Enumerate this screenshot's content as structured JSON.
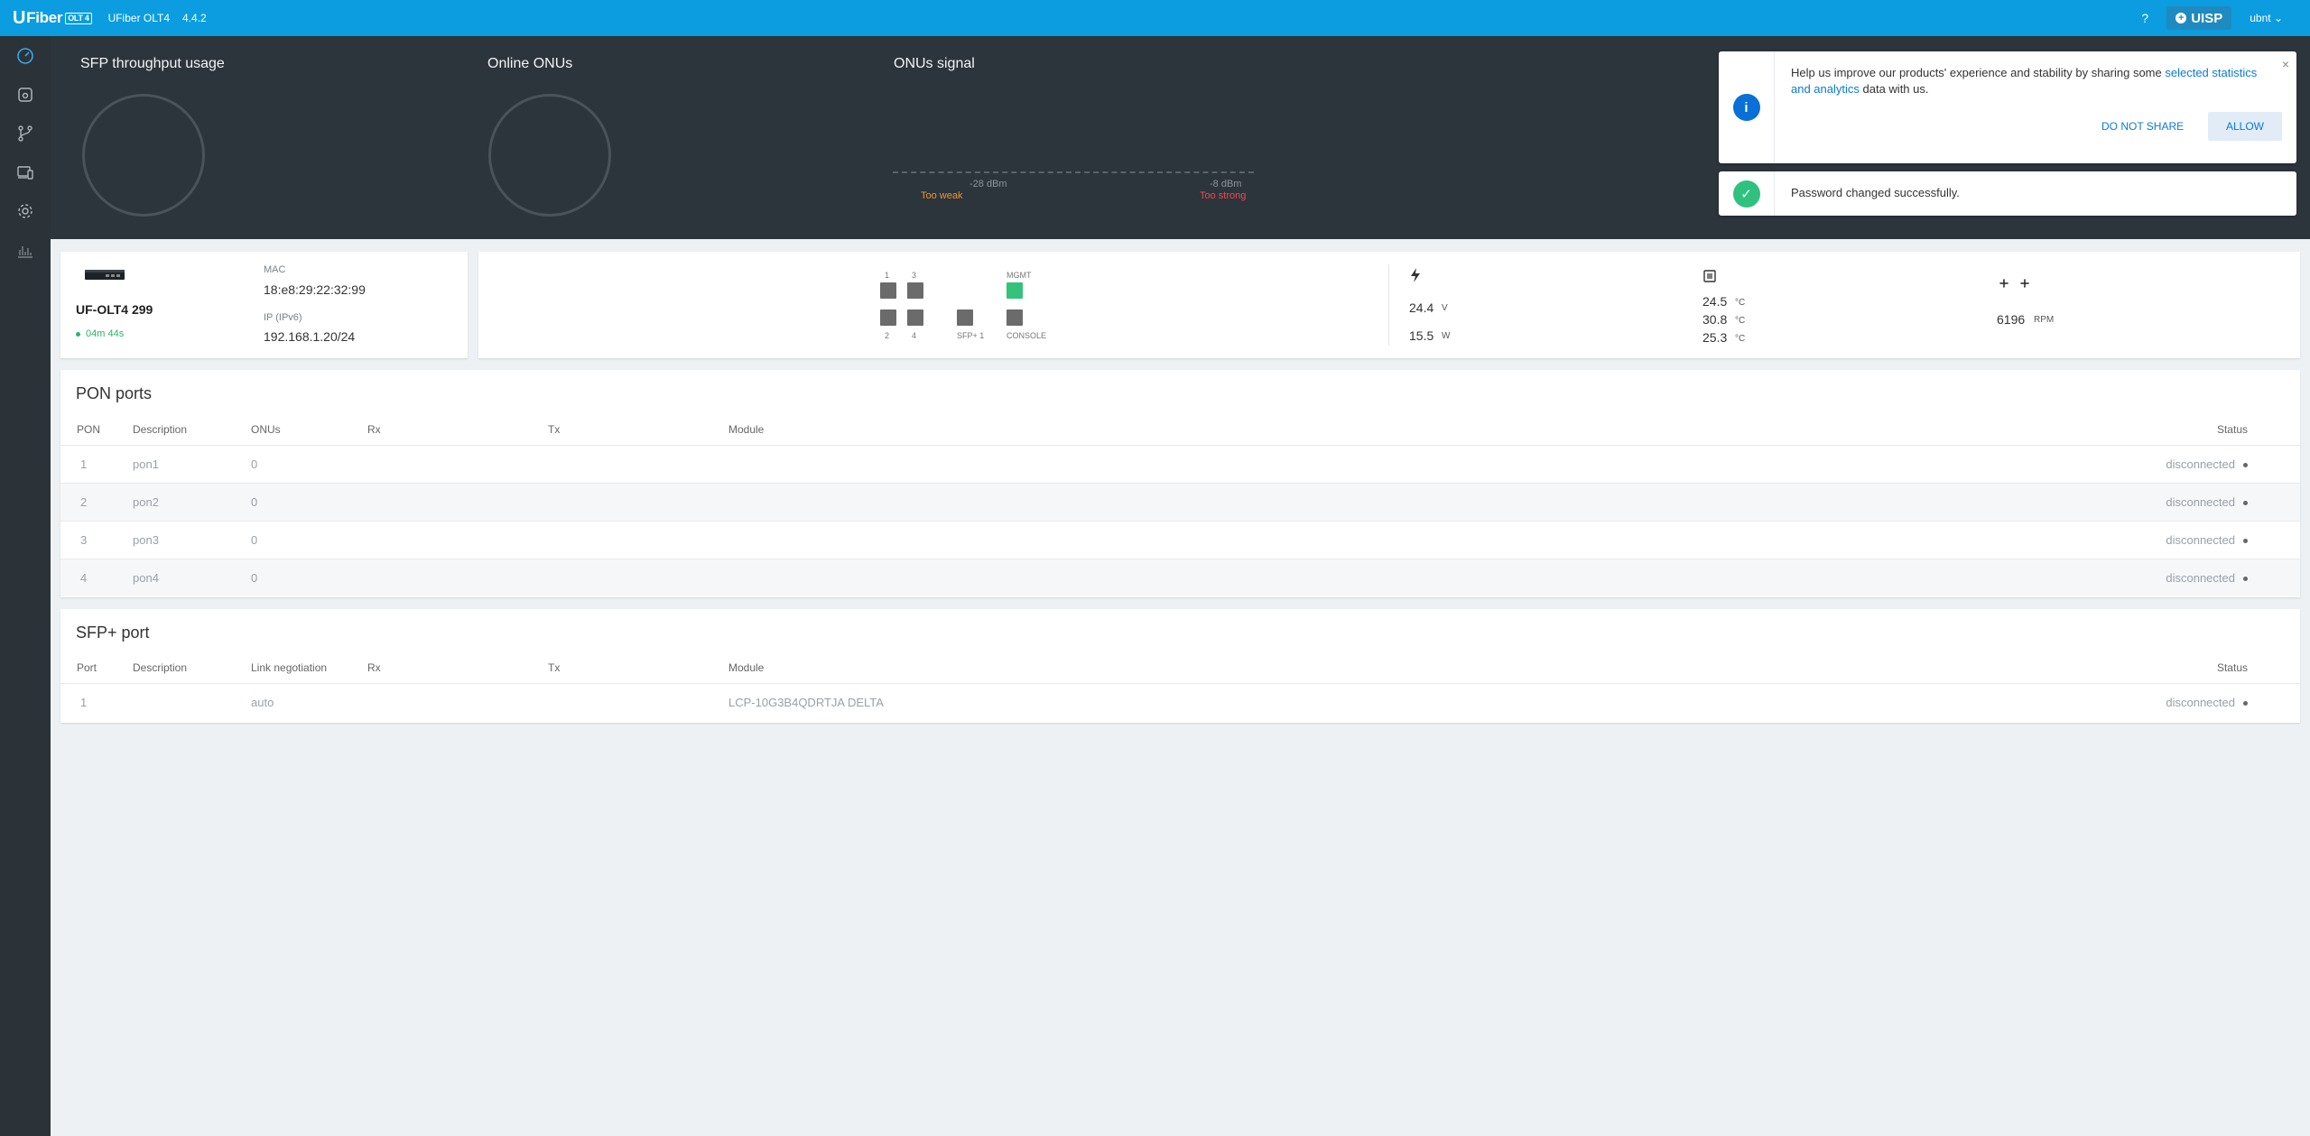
{
  "topbar": {
    "logo_u": "U",
    "logo_text": "Fiber",
    "logo_badge": "OLT 4",
    "model": "UFiber OLT4",
    "version": "4.4.2",
    "help": "?",
    "uisp_label": "UISP",
    "user": "ubnt"
  },
  "sidebar": {
    "items": [
      {
        "icon": "dashboard-icon"
      },
      {
        "icon": "onu-device-icon"
      },
      {
        "icon": "topology-icon"
      },
      {
        "icon": "devices-icon"
      },
      {
        "icon": "gear-icon"
      },
      {
        "icon": "statistics-icon"
      }
    ]
  },
  "dashboard": {
    "sfp_title": "SFP throughput usage",
    "onus_title": "Online ONUs",
    "signal_title": "ONUs signal",
    "sig_left": "-28 dBm",
    "sig_right": "-8 dBm",
    "too_weak": "Too weak",
    "too_strong": "Too strong"
  },
  "toasts": {
    "info": {
      "text_before": "Help us improve our products' experience and stability by sharing some ",
      "link": "selected statistics and analytics",
      "text_after": " data with us.",
      "do_not_share": "DO NOT SHARE",
      "allow": "ALLOW",
      "close": "×"
    },
    "success": {
      "text": "Password changed successfully."
    }
  },
  "device": {
    "name": "UF-OLT4 299",
    "uptime": "04m 44s",
    "mac_label": "MAC",
    "mac": "18:e8:29:22:32:99",
    "ip_label": "IP (IPv6)",
    "ip": "192.168.1.20/24"
  },
  "ports": {
    "labels_top": [
      "1",
      "3"
    ],
    "labels_bottom": [
      "2",
      "4"
    ],
    "sfp_label": "SFP+ 1",
    "mgmt_label": "MGMT",
    "console_label": "CONSOLE",
    "accent_color": "#35c27a"
  },
  "stats": {
    "voltage": "24.4",
    "voltage_unit": "V",
    "power": "15.5",
    "power_unit": "W",
    "temps": [
      "24.5",
      "30.8",
      "25.3"
    ],
    "temp_unit": "°C",
    "fan_rpm": "6196",
    "fan_unit": "RPM"
  },
  "pon_ports": {
    "title": "PON ports",
    "headers": [
      "PON",
      "Description",
      "ONUs",
      "Rx",
      "Tx",
      "Module",
      "Status"
    ],
    "rows": [
      {
        "pon": "1",
        "desc": "pon1",
        "onus": "0",
        "status": "disconnected"
      },
      {
        "pon": "2",
        "desc": "pon2",
        "onus": "0",
        "status": "disconnected"
      },
      {
        "pon": "3",
        "desc": "pon3",
        "onus": "0",
        "status": "disconnected"
      },
      {
        "pon": "4",
        "desc": "pon4",
        "onus": "0",
        "status": "disconnected"
      }
    ]
  },
  "sfp_port": {
    "title": "SFP+ port",
    "headers": [
      "Port",
      "Description",
      "Link negotiation",
      "Rx",
      "Tx",
      "Module",
      "Status"
    ],
    "rows": [
      {
        "port": "1",
        "link": "auto",
        "module": "LCP-10G3B4QDRTJA DELTA",
        "status": "disconnected"
      }
    ]
  }
}
